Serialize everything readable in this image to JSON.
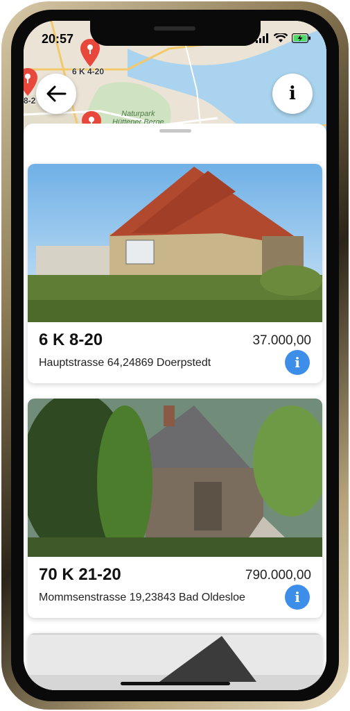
{
  "status_bar": {
    "time": "20:57"
  },
  "map": {
    "pins": [
      {
        "label": "6 K 4-20"
      },
      {
        "label": "8-2"
      },
      {
        "label": ""
      }
    ],
    "park_label_line1": "Naturpark",
    "park_label_line2": "Hüttener Berge",
    "back_button_icon": "arrow-left-icon",
    "info_button_label": "i"
  },
  "listings": [
    {
      "title": "6 K 8-20",
      "price": "37.000,00",
      "address": "Hauptstrasse 64,24869 Doerpstedt",
      "info_icon_label": "i"
    },
    {
      "title": "70 K 21-20",
      "price": "790.000,00",
      "address": "Mommsenstrasse 19,23843 Bad Oldesloe",
      "info_icon_label": "i"
    },
    {
      "title": "",
      "price": "",
      "address": ""
    }
  ],
  "colors": {
    "accent_blue": "#3d8ee8",
    "pin_red": "#e8483c",
    "map_water": "#a9d3ee",
    "map_land": "#eae3d6"
  }
}
